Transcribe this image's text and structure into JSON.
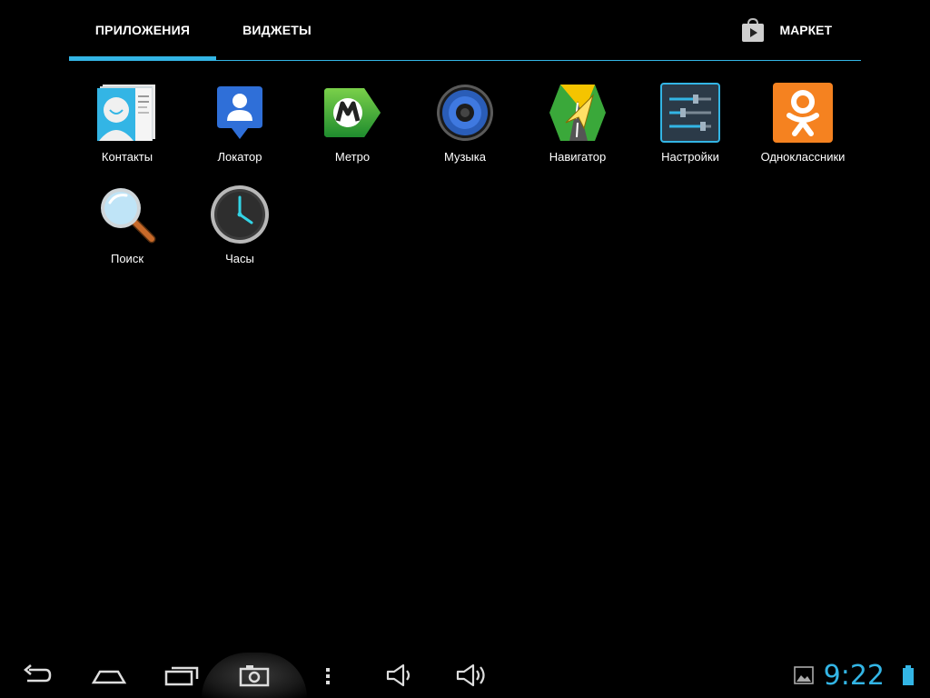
{
  "tabs": {
    "apps_label": "ПРИЛОЖЕНИЯ",
    "widgets_label": "ВИДЖЕТЫ",
    "market_label": "МАРКЕТ",
    "accent": "#33b5e5"
  },
  "apps": [
    {
      "label": "Контакты",
      "icon": "contacts-icon"
    },
    {
      "label": "Локатор",
      "icon": "locator-icon"
    },
    {
      "label": "Метро",
      "icon": "metro-icon"
    },
    {
      "label": "Музыка",
      "icon": "music-icon"
    },
    {
      "label": "Навигатор",
      "icon": "navigator-icon"
    },
    {
      "label": "Настройки",
      "icon": "settings-icon"
    },
    {
      "label": "Одноклассники",
      "icon": "odnoklassniki-icon"
    },
    {
      "label": "Поиск",
      "icon": "search-icon"
    },
    {
      "label": "Часы",
      "icon": "clock-icon"
    }
  ],
  "status": {
    "time": "9:22"
  }
}
